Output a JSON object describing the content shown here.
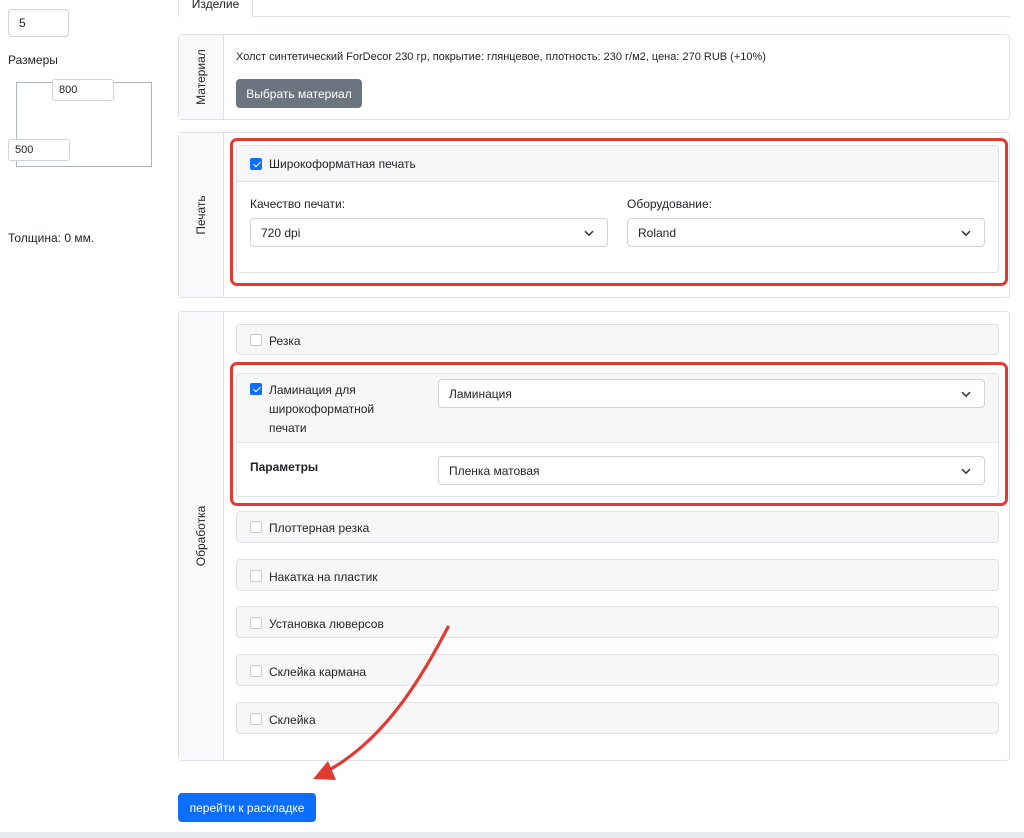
{
  "left": {
    "quantity_value": "5",
    "sizes_label": "Размеры",
    "width_value": "800",
    "height_value": "500",
    "thickness_text": "Толщина: 0 мм."
  },
  "tabs": {
    "product": "Изделие"
  },
  "material": {
    "legend": "Материал",
    "description": "Холст синтетический ForDecor 230 гр, покрытие: глянцевое, плотность: 230 г/м2, цена: 270 RUB (+10%)",
    "choose_button": "Выбрать материал"
  },
  "print": {
    "legend": "Печать",
    "wide_format": {
      "label": "Широкоформатная печать",
      "checked": true
    },
    "quality_label": "Качество печати:",
    "quality_value": "720 dpi",
    "equipment_label": "Оборудование:",
    "equipment_value": "Roland"
  },
  "processing": {
    "legend": "Обработка",
    "cutting": {
      "label": "Резка",
      "checked": false
    },
    "lamination": {
      "label_line1": "Ламинация для",
      "label_line2": "широкоформатной",
      "label_line3": "печати",
      "checked": true,
      "type_value": "Ламинация",
      "params_label": "Параметры",
      "params_value": "Пленка матовая"
    },
    "plotter_cutting": {
      "label": "Плоттерная резка",
      "checked": false
    },
    "plastic_mounting": {
      "label": "Накатка на пластик",
      "checked": false
    },
    "grommets": {
      "label": "Установка люверсов",
      "checked": false
    },
    "pocket_gluing": {
      "label": "Склейка кармана",
      "checked": false
    },
    "gluing": {
      "label": "Склейка",
      "checked": false
    }
  },
  "actions": {
    "go_to_layout": "перейти к раскладке"
  },
  "colors": {
    "primary": "#0d6efd",
    "highlight": "#e03a33",
    "secondary_button": "#6c757d"
  },
  "icons": {
    "select_caret": "chevron-down-icon",
    "annotation_arrow": "curved-arrow-icon"
  }
}
